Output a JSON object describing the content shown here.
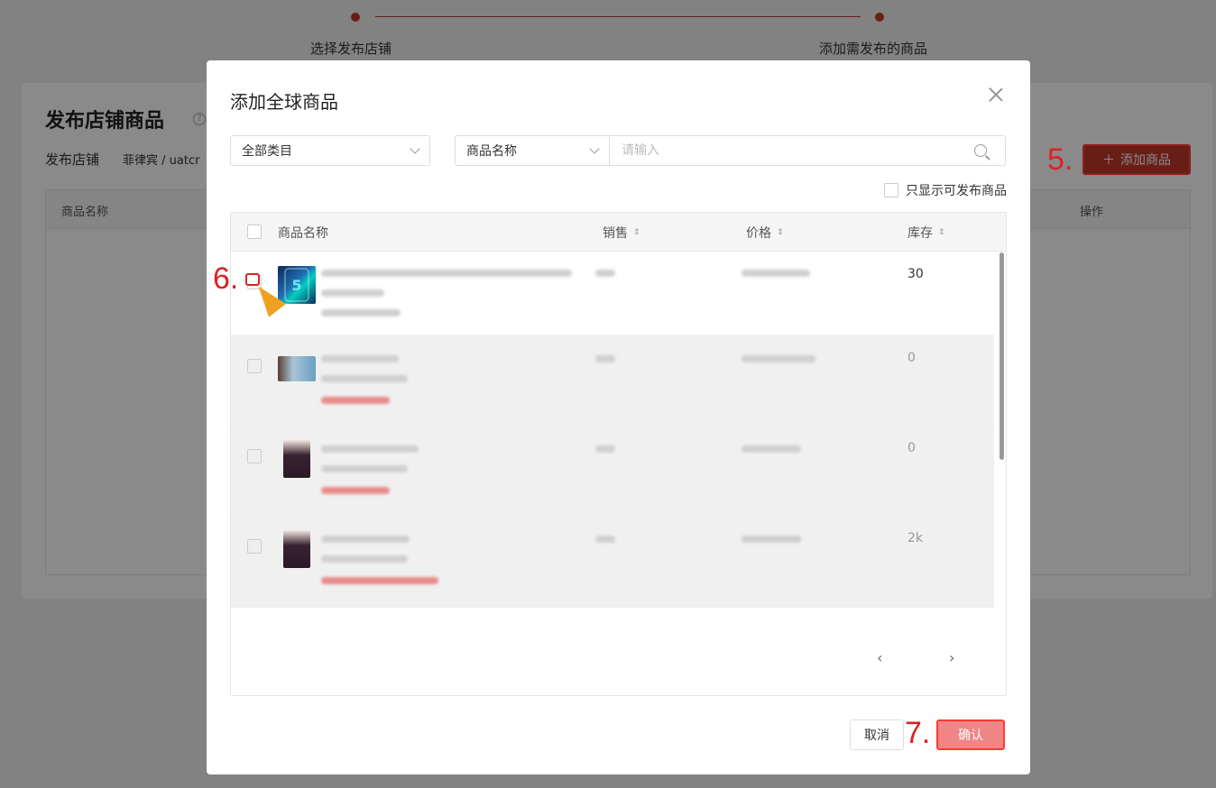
{
  "steps": {
    "step1": "选择发布店铺",
    "step2": "添加需发布的商品"
  },
  "background": {
    "title": "发布店铺商品",
    "store_label": "发布店铺",
    "store_value": "菲律宾 / uatcr",
    "add_button": "添加商品",
    "col_name": "商品名称",
    "col_action": "操作"
  },
  "modal": {
    "title": "添加全球商品",
    "category_select": "全部类目",
    "field_select": "商品名称",
    "search_placeholder": "请输入",
    "only_publishable": "只显示可发布商品",
    "columns": {
      "name": "商品名称",
      "sales": "销售",
      "price": "价格",
      "stock": "库存"
    },
    "rows": [
      {
        "stock": "30"
      },
      {
        "stock": "0"
      },
      {
        "stock": "0"
      },
      {
        "stock": "2k"
      }
    ],
    "cancel": "取消",
    "confirm": "确认"
  },
  "annotations": {
    "a5": "5.",
    "a6": "6.",
    "a7": "7."
  },
  "colors": {
    "primary": "#c0392b",
    "annotation": "#e02020",
    "confirm_bg": "#f08585"
  }
}
